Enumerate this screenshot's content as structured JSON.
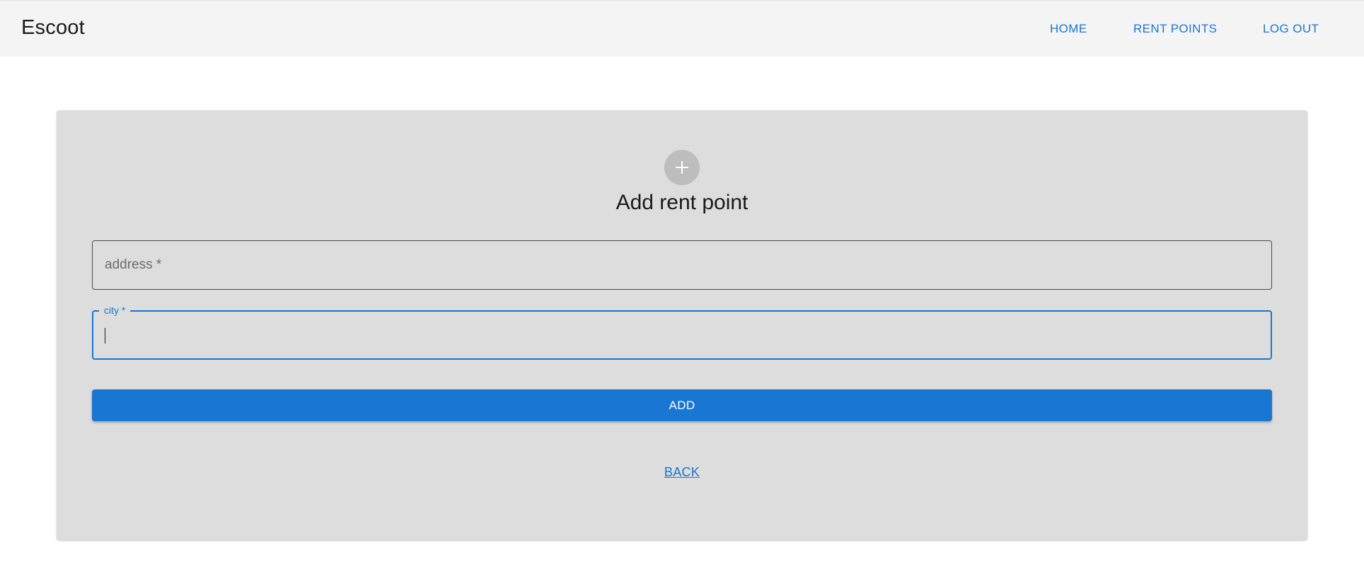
{
  "app": {
    "brand": "Escoot"
  },
  "nav": {
    "home": "HOME",
    "rent_points": "RENT POINTS",
    "log_out": "LOG OUT"
  },
  "form": {
    "icon": "plus-icon",
    "title": "Add rent point",
    "address": {
      "placeholder": "address *",
      "value": ""
    },
    "city": {
      "label": "city *",
      "value": ""
    },
    "submit_label": "ADD",
    "back_label": "BACK"
  },
  "colors": {
    "accent": "#1976d2",
    "card_background": "#dddddd",
    "appbar_background": "#f4f4f4"
  }
}
